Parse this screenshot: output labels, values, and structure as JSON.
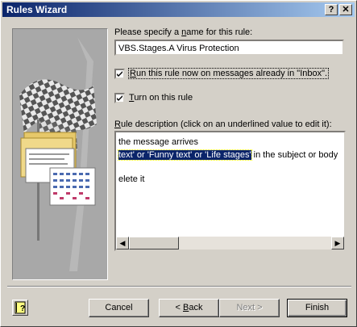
{
  "window": {
    "title": "Rules Wizard",
    "help_btn": "?",
    "close_btn": "✕"
  },
  "rule_name": {
    "label_pre": "Please specify a ",
    "label_underlined": "n",
    "label_post": "ame for this rule:",
    "value": "VBS.Stages.A Virus Protection"
  },
  "run_now": {
    "underlined": "R",
    "rest": "un this rule now on messages already in \"Inbox\".",
    "checked": true
  },
  "turn_on": {
    "underlined": "T",
    "rest": "urn on this rule",
    "checked": true
  },
  "description": {
    "label_underlined": "R",
    "label_rest": "ule description (click on an underlined value to edit it):",
    "line1": " the message arrives",
    "line2_highlight": "text' or 'Funny text' or 'Life stages'",
    "line2_rest": " in the subject or body",
    "line3": "elete it",
    "scroll_left": "◀",
    "scroll_right": "▶"
  },
  "buttons": {
    "cancel": "Cancel",
    "back_pre": "< ",
    "back_underlined": "B",
    "back_post": "ack",
    "next": "Next >",
    "finish": "Finish"
  },
  "help_icon": "help-book-icon"
}
